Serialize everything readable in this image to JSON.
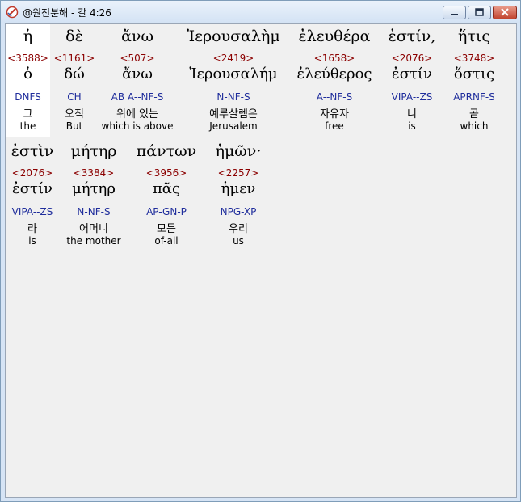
{
  "window": {
    "title": "@원전분해 - 갈 4:26"
  },
  "rows": [
    [
      {
        "greek": "ἡ",
        "strong": "<3588>",
        "lemma": "ὁ",
        "parse": "DNFS",
        "korean": "그",
        "english": "the"
      },
      {
        "greek": "δὲ",
        "strong": "<1161>",
        "lemma": "δώ",
        "parse": "CH",
        "korean": "오직",
        "english": "But"
      },
      {
        "greek": "ἄνω",
        "strong": "<507>",
        "lemma": "ἄνω",
        "parse": "AB A--NF-S",
        "korean": "위에 있는",
        "english": "which is above"
      },
      {
        "greek": "Ἰερουσαλὴμ",
        "strong": "<2419>",
        "lemma": "Ἱερουσαλήμ",
        "parse": "N-NF-S",
        "korean": "예루살렘은",
        "english": "Jerusalem"
      },
      {
        "greek": "ἐλευθέρα",
        "strong": "<1658>",
        "lemma": "ἐλεύθερος",
        "parse": "A--NF-S",
        "korean": "자유자",
        "english": "free"
      },
      {
        "greek": "ἐστίν,",
        "strong": "<2076>",
        "lemma": "ἐστίν",
        "parse": "VIPA--ZS",
        "korean": "니",
        "english": "is"
      },
      {
        "greek": "ἥτις",
        "strong": "<3748>",
        "lemma": "ὅστις",
        "parse": "APRNF-S",
        "korean": "곧",
        "english": "which"
      }
    ],
    [
      {
        "greek": "ἐστὶν",
        "strong": "<2076>",
        "lemma": "ἐστίν",
        "parse": "VIPA--ZS",
        "korean": "라",
        "english": "is"
      },
      {
        "greek": "μήτηρ",
        "strong": "<3384>",
        "lemma": "μήτηρ",
        "parse": "N-NF-S",
        "korean": "어머니",
        "english": "the mother"
      },
      {
        "greek": "πάντων",
        "strong": "<3956>",
        "lemma": "πᾶς",
        "parse": "AP-GN-P",
        "korean": "모든",
        "english": "of-all"
      },
      {
        "greek": "ἡμῶν·",
        "strong": "<2257>",
        "lemma": "ἡμεν",
        "parse": "NPG-XP",
        "korean": "우리",
        "english": "us"
      }
    ]
  ]
}
